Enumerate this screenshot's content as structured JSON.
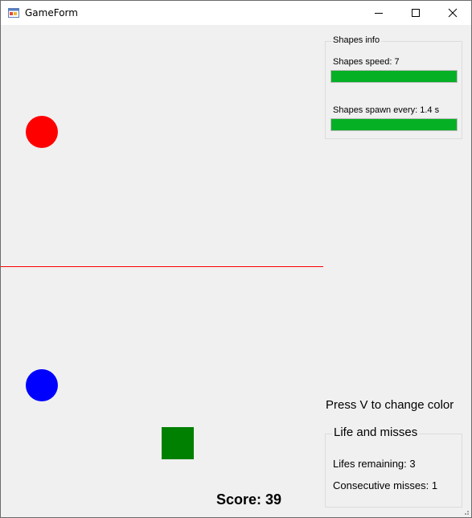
{
  "window": {
    "title": "GameForm",
    "icon": "winforms-app-icon"
  },
  "titlebar_controls": {
    "minimize_icon": "minimize-icon",
    "maximize_icon": "maximize-icon",
    "close_icon": "close-icon"
  },
  "game": {
    "shapes": [
      {
        "type": "circle",
        "color": "#ff0000"
      },
      {
        "type": "circle",
        "color": "#0000ff"
      },
      {
        "type": "square",
        "color": "#008000"
      }
    ],
    "line_color": "#ff0000"
  },
  "shapes_info": {
    "caption": "Shapes info",
    "speed_label": "Shapes speed: 7",
    "speed_progress": 1.0,
    "spawn_label": "Shapes spawn every: 1.4 s",
    "spawn_progress": 1.0,
    "progress_color": "#06b025"
  },
  "hint": "Press V to change color",
  "life_and_misses": {
    "caption": "Life and misses",
    "lifes_label": "Lifes remaining: 3",
    "misses_label": "Consecutive misses: 1"
  },
  "score_label": "Score: 39"
}
